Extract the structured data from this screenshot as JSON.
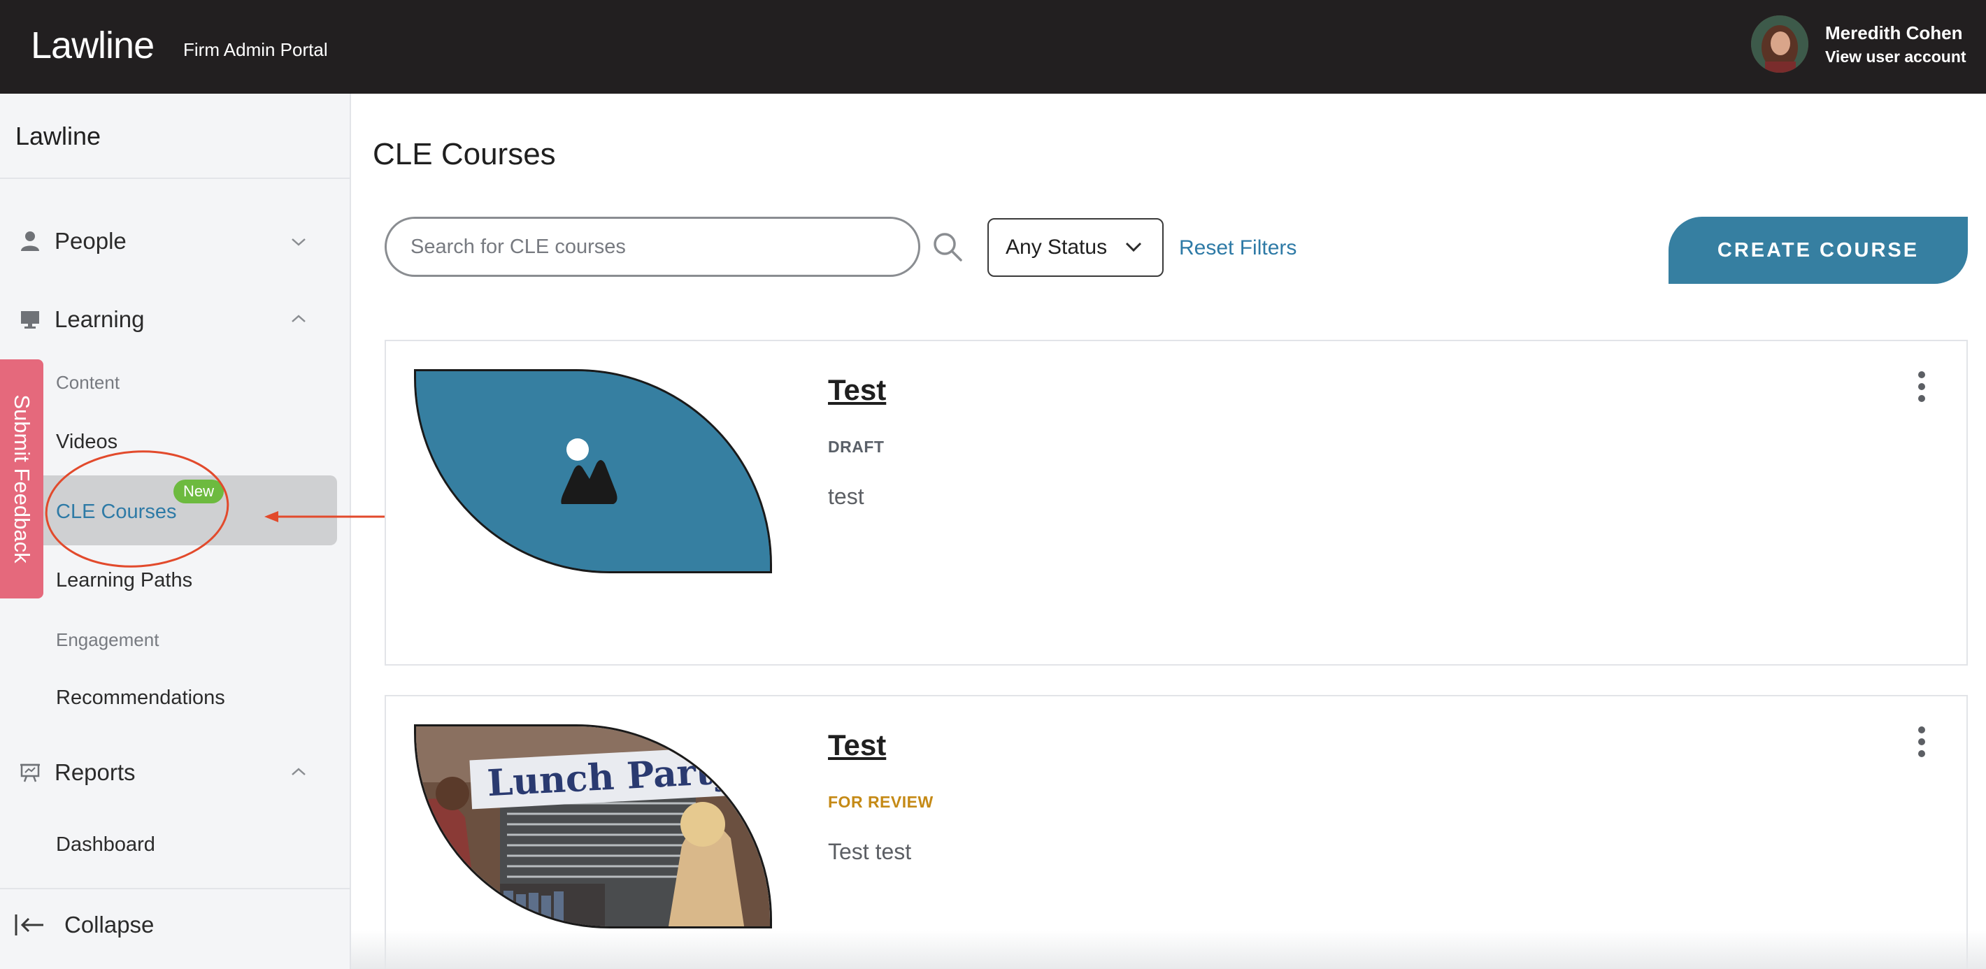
{
  "header": {
    "brand": "Lawline",
    "portal": "Firm Admin Portal",
    "user_name": "Meredith Cohen",
    "user_link": "View user account"
  },
  "sidebar": {
    "title": "Lawline",
    "groups": [
      {
        "label": "People",
        "icon": "person-icon",
        "expanded": false
      },
      {
        "label": "Learning",
        "icon": "monitor-icon",
        "expanded": true
      },
      {
        "label": "Reports",
        "icon": "presentation-icon",
        "expanded": true
      }
    ],
    "sections": {
      "content": "Content",
      "engagement": "Engagement"
    },
    "items": {
      "videos": "Videos",
      "cle_courses": "CLE Courses",
      "learning_paths": "Learning Paths",
      "recommendations": "Recommendations",
      "dashboard": "Dashboard"
    },
    "new_badge": "New",
    "collapse": "Collapse"
  },
  "feedback": "Submit Feedback",
  "main": {
    "title": "CLE Courses",
    "search_placeholder": "Search for CLE courses",
    "status_filter": "Any Status",
    "reset_filters": "Reset Filters",
    "create_button": "CREATE COURSE"
  },
  "courses": [
    {
      "title": "Test",
      "status": "DRAFT",
      "description": "test",
      "thumbnail": "image-placeholder-icon"
    },
    {
      "title": "Test",
      "status": "FOR REVIEW",
      "description": "Test test",
      "thumbnail": "photo",
      "thumbnail_text": "Lunch Party"
    }
  ],
  "colors": {
    "accent": "#367fa1",
    "link": "#2e7aa6",
    "badge_new": "#6dba3f",
    "feedback": "#e5697c",
    "status_review": "#c58a16",
    "annotation": "#e24a2c"
  }
}
